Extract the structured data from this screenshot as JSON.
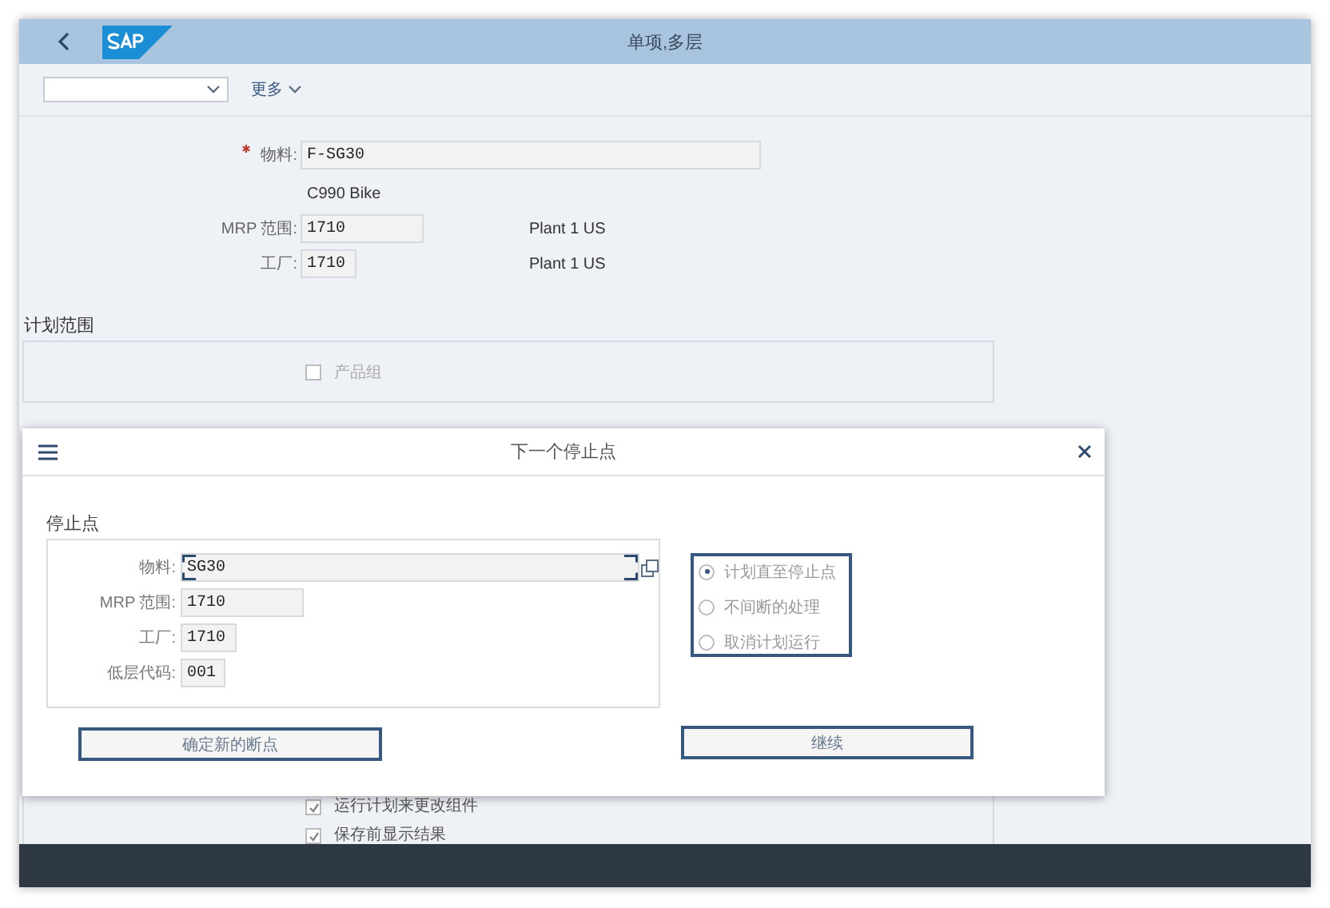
{
  "header": {
    "title": "单项,多层"
  },
  "toolbar": {
    "more": "更多"
  },
  "form": {
    "fields": [
      {
        "label": "物料:",
        "required": true,
        "value": "F-SG30",
        "note": "C990 Bike"
      },
      {
        "label": "MRP 范围:",
        "required": false,
        "value": "1710",
        "aside": "Plant 1 US"
      },
      {
        "label": "工厂:",
        "required": false,
        "value": "1710",
        "aside": "Plant 1 US"
      }
    ]
  },
  "planning_scope": {
    "title": "计划范围",
    "options": [
      {
        "label": "产品组",
        "checked": false,
        "disabled": true
      }
    ]
  },
  "lower_options": [
    {
      "label": "运行计划来更改组件",
      "checked": true
    },
    {
      "label": "保存前显示结果",
      "checked": true
    }
  ],
  "dialog": {
    "title": "下一个停止点",
    "section": "停止点",
    "fields": [
      {
        "label": "物料:",
        "value": "SG30",
        "focused": true
      },
      {
        "label": "MRP 范围:",
        "value": "1710",
        "focused": false
      },
      {
        "label": "工厂:",
        "value": "1710",
        "focused": false
      },
      {
        "label": "低层代码:",
        "value": "001",
        "focused": false
      }
    ],
    "radios": [
      {
        "label": "计划直至停止点",
        "selected": true
      },
      {
        "label": "不间断的处理",
        "selected": false
      },
      {
        "label": "取消计划运行",
        "selected": false
      }
    ],
    "buttons": [
      "确定新的断点",
      "继续"
    ]
  }
}
